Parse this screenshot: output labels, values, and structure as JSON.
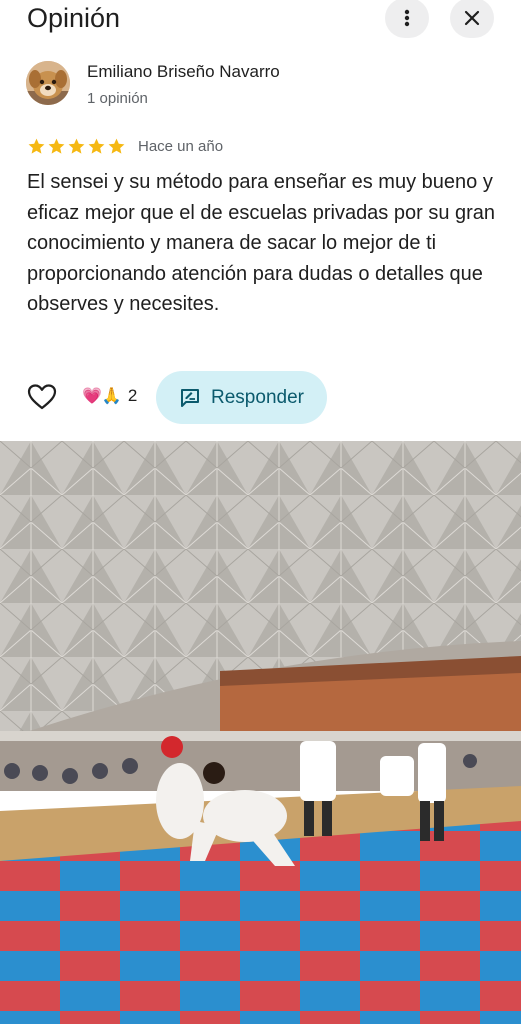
{
  "header": {
    "title": "Opinión",
    "more_icon": "more-vert-icon",
    "close_icon": "close-icon"
  },
  "review": {
    "author": {
      "name": "Emiliano Briseño Navarro",
      "meta": "1 opinión",
      "avatar_icon": "dog-avatar"
    },
    "rating": 5,
    "rating_max": 5,
    "star_color": "#f5b812",
    "time": "Hace un año",
    "text": "El sensei y su método para enseñar es muy bueno y eficaz mejor que el de escuelas privadas por su gran conocimiento y manera de sacar lo mejor de ti proporcionando atención para dudas o detalles que observes y necesites."
  },
  "actions": {
    "like_icon": "heart-outline-icon",
    "reactions": {
      "emojis": "💗🙏",
      "count": "2"
    },
    "reply": {
      "label": "Responder",
      "icon": "rate-review-icon",
      "bg": "#d3f0f6",
      "color": "#0b5a6d"
    }
  },
  "photo": {
    "subject": "karate-tournament-photo"
  }
}
